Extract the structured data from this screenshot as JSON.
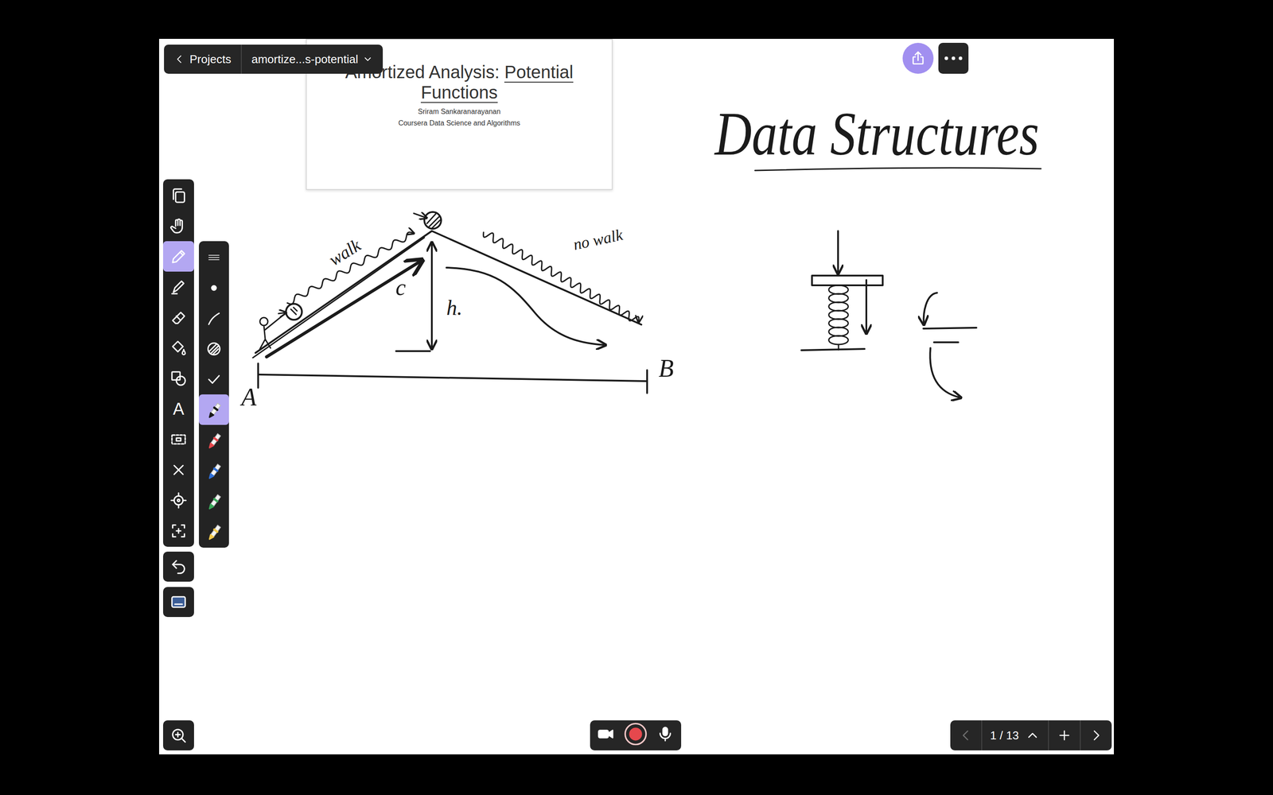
{
  "app_bar": {
    "back_label": "Projects",
    "document": "amortize...s-potential"
  },
  "slide": {
    "title_plain": "Amortized Analysis:",
    "title_underlined": "Potential",
    "title_line2": "Functions",
    "author": "Sriram Sankaranarayanan",
    "course": "Coursera Data Science and Algorithms"
  },
  "tools": [
    {
      "kind": "pages",
      "selected": false
    },
    {
      "kind": "hand",
      "selected": false
    },
    {
      "kind": "pen",
      "selected": true
    },
    {
      "kind": "pencil",
      "selected": false
    },
    {
      "kind": "eraser",
      "selected": false
    },
    {
      "kind": "fill",
      "selected": false
    },
    {
      "kind": "shapes",
      "selected": false
    },
    {
      "kind": "text",
      "label": "A",
      "selected": false
    },
    {
      "kind": "lasso",
      "selected": false
    },
    {
      "kind": "close",
      "selected": false
    },
    {
      "kind": "laser",
      "selected": false
    },
    {
      "kind": "crop",
      "selected": false
    }
  ],
  "stroke_options": [
    {
      "kind": "handle"
    },
    {
      "kind": "dot"
    },
    {
      "kind": "curve"
    },
    {
      "kind": "pattern"
    },
    {
      "kind": "check"
    }
  ],
  "pens": [
    {
      "color": "#1a1a1a",
      "selected": true
    },
    {
      "color": "#e5484d",
      "selected": false
    },
    {
      "color": "#2f6fd6",
      "selected": false
    },
    {
      "color": "#3aa85a",
      "selected": false
    },
    {
      "color": "#f2c94c",
      "selected": false
    }
  ],
  "canvas": {
    "heading": "Data Structures",
    "labels": [
      "walk",
      "no walk",
      "c",
      "h.",
      "A",
      "B"
    ]
  },
  "pager": {
    "previous_disabled": true,
    "label": "1 / 13"
  }
}
